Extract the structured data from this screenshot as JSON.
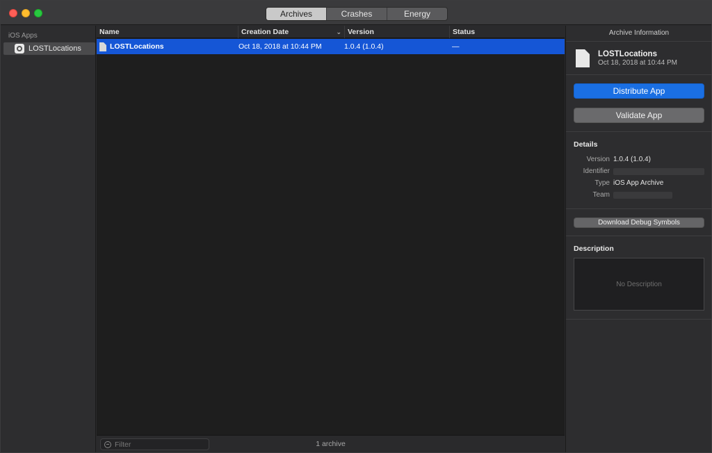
{
  "tabs": [
    "Archives",
    "Crashes",
    "Energy"
  ],
  "active_tab_index": 0,
  "sidebar": {
    "header": "iOS Apps",
    "items": [
      {
        "label": "LOSTLocations"
      }
    ]
  },
  "table": {
    "columns": [
      "Name",
      "Creation Date",
      "Version",
      "Status"
    ],
    "rows": [
      {
        "name": "LOSTLocations",
        "creation_date": "Oct 18, 2018 at 10:44 PM",
        "version": "1.0.4 (1.0.4)",
        "status": "—"
      }
    ],
    "sort_indicator": "chevron-down"
  },
  "footer": {
    "filter_placeholder": "Filter",
    "count_text": "1 archive"
  },
  "inspector": {
    "title": "Archive Information",
    "archive_name": "LOSTLocations",
    "archive_date": "Oct 18, 2018 at 10:44 PM",
    "distribute_label": "Distribute App",
    "validate_label": "Validate App",
    "details_header": "Details",
    "details": {
      "version_label": "Version",
      "version_value": "1.0.4 (1.0.4)",
      "identifier_label": "Identifier",
      "type_label": "Type",
      "type_value": "iOS App Archive",
      "team_label": "Team"
    },
    "download_symbols_label": "Download Debug Symbols",
    "description_header": "Description",
    "description_placeholder": "No Description"
  },
  "colors": {
    "selection": "#1556d6",
    "primary_button": "#1a6fe3"
  }
}
